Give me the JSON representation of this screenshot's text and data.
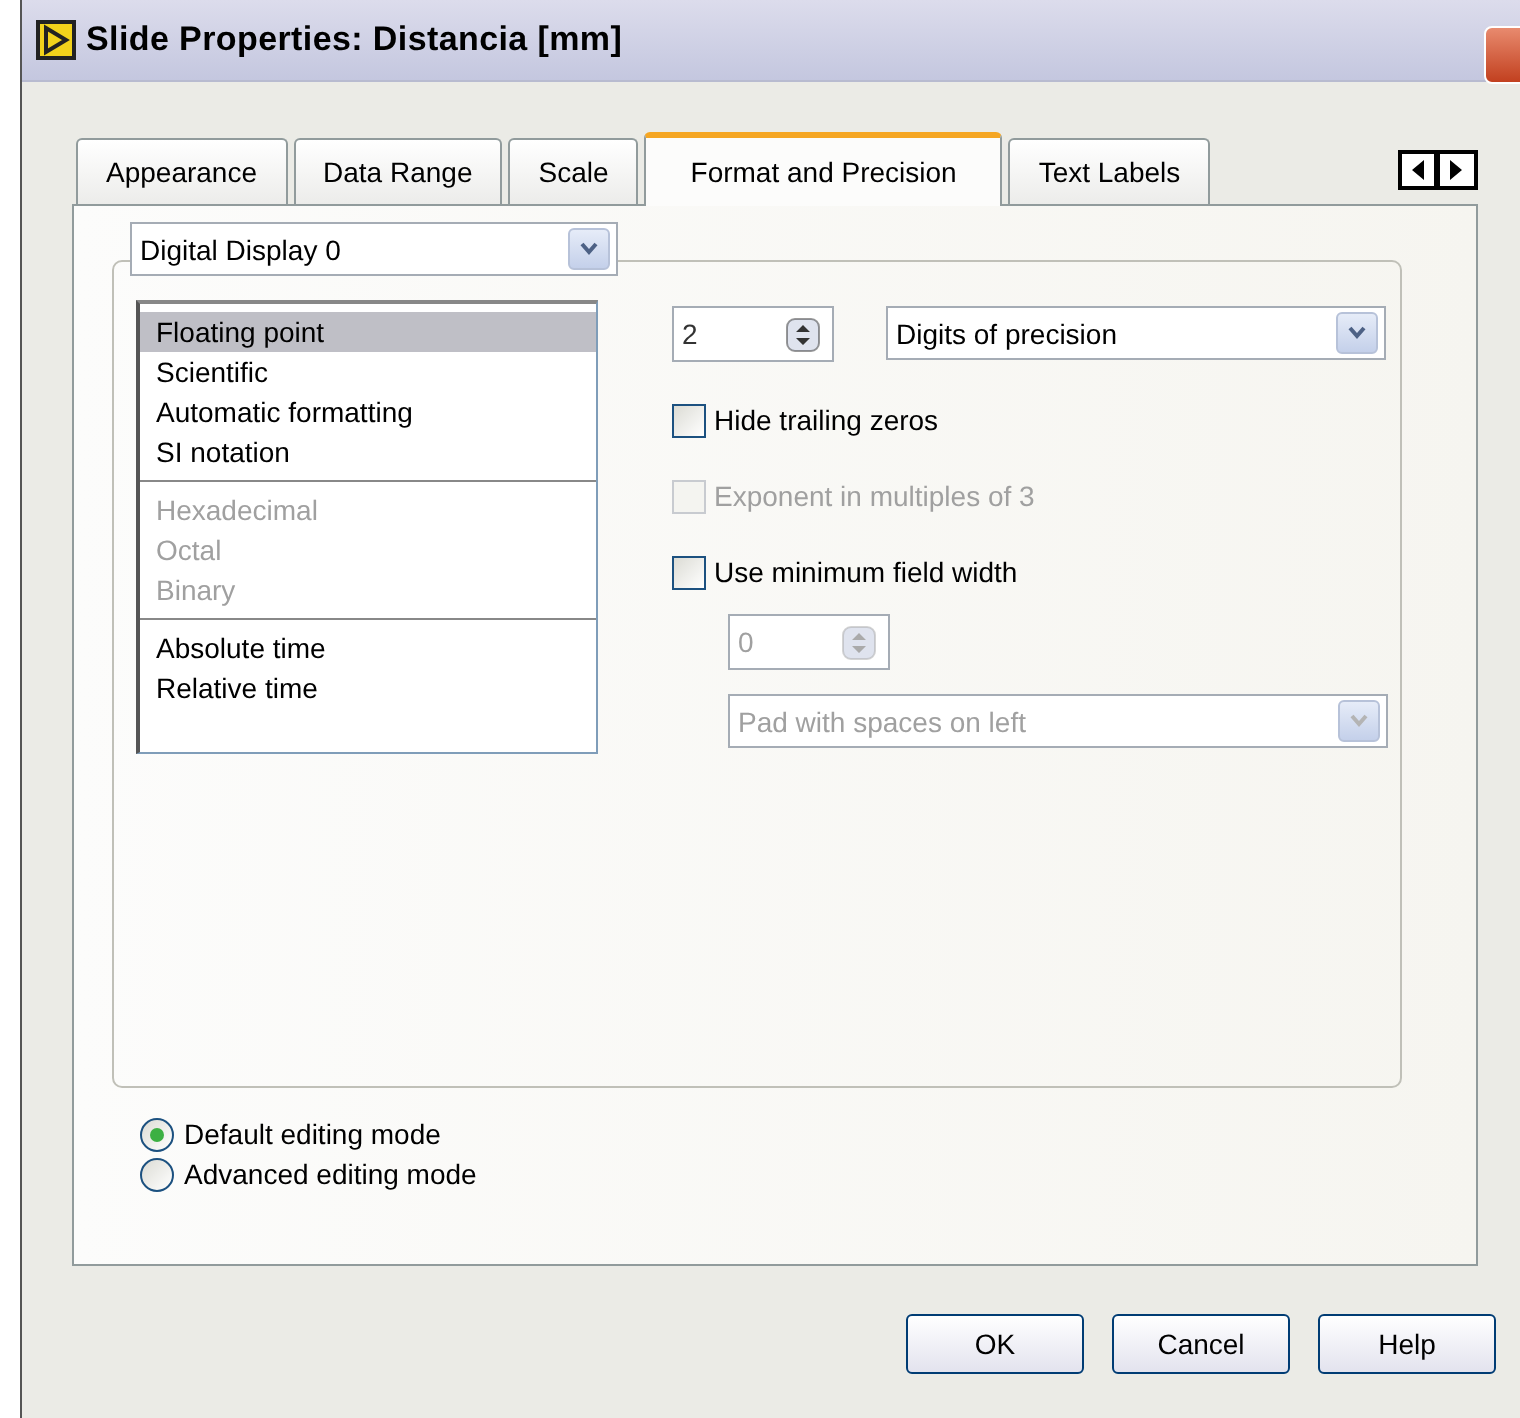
{
  "window": {
    "title": "Slide Properties: Distancia [mm]"
  },
  "tabs": [
    {
      "label": "Appearance",
      "selected": false
    },
    {
      "label": "Data Range",
      "selected": false
    },
    {
      "label": "Scale",
      "selected": false
    },
    {
      "label": "Format and Precision",
      "selected": true
    },
    {
      "label": "Text Labels",
      "selected": false
    }
  ],
  "display_select": {
    "value": "Digital Display 0"
  },
  "format_list": [
    [
      {
        "label": "Floating point",
        "selected": true,
        "disabled": false
      },
      {
        "label": "Scientific",
        "selected": false,
        "disabled": false
      },
      {
        "label": "Automatic formatting",
        "selected": false,
        "disabled": false
      },
      {
        "label": "SI notation",
        "selected": false,
        "disabled": false
      }
    ],
    [
      {
        "label": "Hexadecimal",
        "selected": false,
        "disabled": true
      },
      {
        "label": "Octal",
        "selected": false,
        "disabled": true
      },
      {
        "label": "Binary",
        "selected": false,
        "disabled": true
      }
    ],
    [
      {
        "label": "Absolute time",
        "selected": false,
        "disabled": false
      },
      {
        "label": "Relative time",
        "selected": false,
        "disabled": false
      }
    ]
  ],
  "precision": {
    "value": "2",
    "disabled": false
  },
  "precision_type": {
    "value": "Digits of precision",
    "disabled": false
  },
  "options": [
    {
      "label": "Hide trailing zeros",
      "checked": false,
      "disabled": false
    },
    {
      "label": "Exponent in multiples of 3",
      "checked": false,
      "disabled": true
    },
    {
      "label": "Use minimum field width",
      "checked": false,
      "disabled": false
    }
  ],
  "min_width": {
    "value": "0",
    "disabled": true
  },
  "padding": {
    "value": "Pad with spaces on left",
    "disabled": true
  },
  "editing_modes": [
    {
      "label": "Default editing mode",
      "selected": true
    },
    {
      "label": "Advanced editing mode",
      "selected": false
    }
  ],
  "buttons": [
    "OK",
    "Cancel",
    "Help"
  ]
}
